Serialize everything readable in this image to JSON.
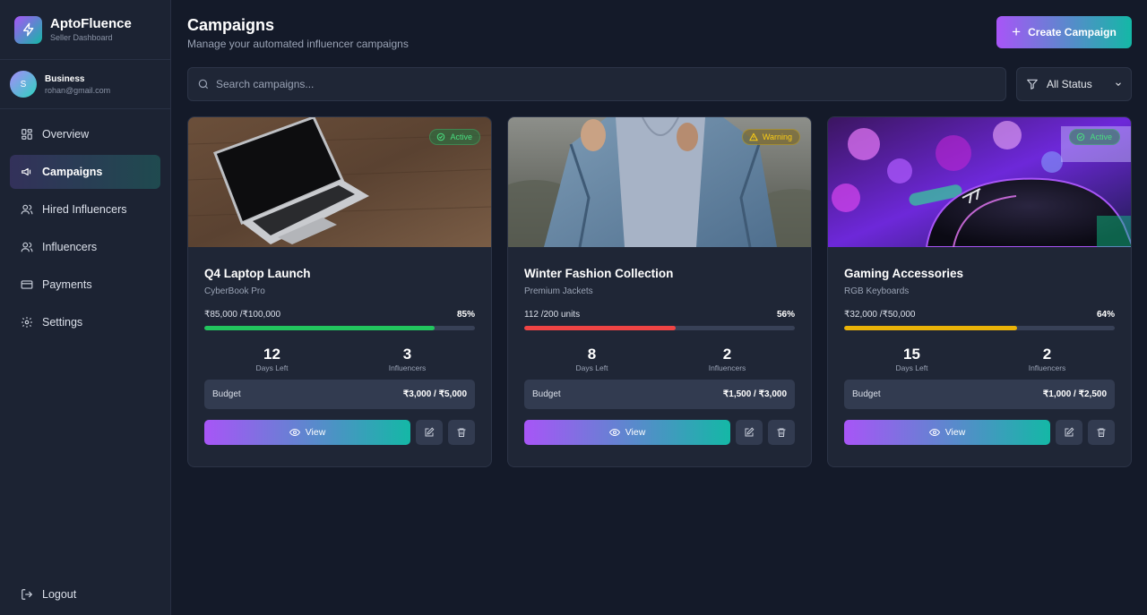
{
  "brand": {
    "name": "AptoFluence",
    "subtitle": "Seller Dashboard"
  },
  "user": {
    "initial": "S",
    "name": "Business",
    "email": "rohan@gmail.com"
  },
  "nav": {
    "items": [
      {
        "label": "Overview",
        "icon": "grid-icon"
      },
      {
        "label": "Campaigns",
        "icon": "megaphone-icon",
        "active": true
      },
      {
        "label": "Hired Influencers",
        "icon": "users-icon"
      },
      {
        "label": "Influencers",
        "icon": "users-icon"
      },
      {
        "label": "Payments",
        "icon": "credit-card-icon"
      },
      {
        "label": "Settings",
        "icon": "gear-icon"
      }
    ],
    "logout": "Logout"
  },
  "header": {
    "title": "Campaigns",
    "subtitle": "Manage your automated influencer campaigns",
    "create_button": "Create Campaign"
  },
  "toolbar": {
    "search_placeholder": "Search campaigns...",
    "filter_value": "All Status"
  },
  "colors": {
    "accent_start": "#a855f7",
    "accent_end": "#14b8a6",
    "progress_green": "#22c55e",
    "progress_red": "#ef4444",
    "progress_yellow": "#eab308"
  },
  "labels": {
    "days_left": "Days Left",
    "influencers": "Influencers",
    "budget": "Budget",
    "view": "View"
  },
  "campaigns": [
    {
      "title": "Q4 Laptop Launch",
      "product": "CyberBook Pro",
      "status": "Active",
      "progress_text": "₹85,000 /₹100,000",
      "progress_pct": "85%",
      "progress_value": 0.85,
      "progress_color": "#22c55e",
      "days_left": "12",
      "influencers": "3",
      "budget": "₹3,000 / ₹5,000"
    },
    {
      "title": "Winter Fashion Collection",
      "product": "Premium Jackets",
      "status": "Warning",
      "progress_text": "112 /200 units",
      "progress_pct": "56%",
      "progress_value": 0.56,
      "progress_color": "#ef4444",
      "days_left": "8",
      "influencers": "2",
      "budget": "₹1,500 / ₹3,000"
    },
    {
      "title": "Gaming Accessories",
      "product": "RGB Keyboards",
      "status": "Active",
      "progress_text": "₹32,000 /₹50,000",
      "progress_pct": "64%",
      "progress_value": 0.64,
      "progress_color": "#eab308",
      "days_left": "15",
      "influencers": "2",
      "budget": "₹1,000 / ₹2,500"
    }
  ]
}
